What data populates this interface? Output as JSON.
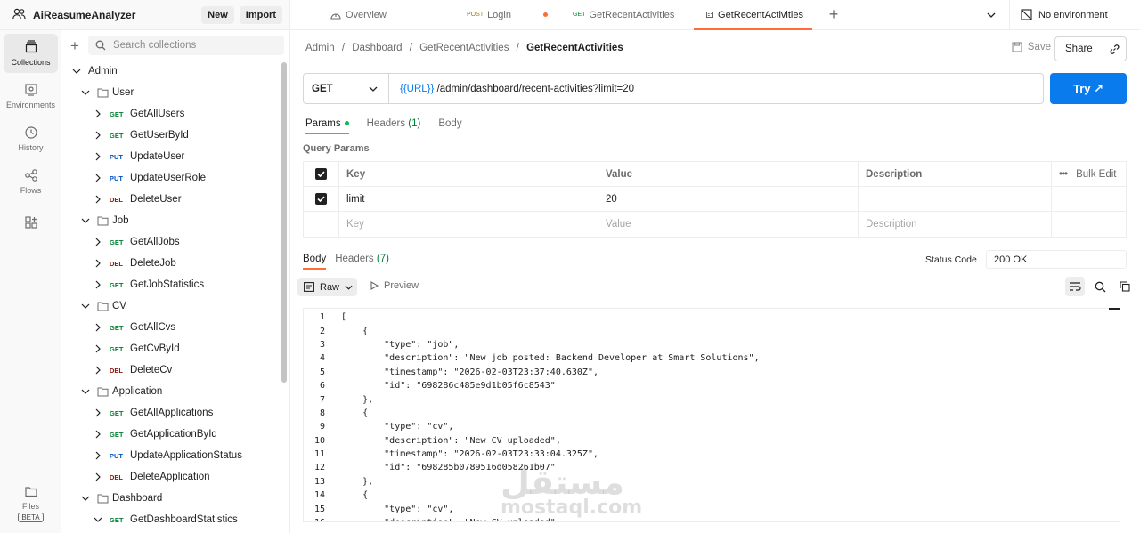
{
  "workspace": {
    "title": "AiReasumeAnalyzer",
    "new_label": "New",
    "import_label": "Import"
  },
  "rail": [
    {
      "label": "Collections",
      "icon": "collections-icon",
      "active": true
    },
    {
      "label": "Environments",
      "icon": "environments-icon",
      "active": false
    },
    {
      "label": "History",
      "icon": "history-icon",
      "active": false
    },
    {
      "label": "Flows",
      "icon": "flows-icon",
      "active": false
    },
    {
      "label": "",
      "icon": "add-apps-icon",
      "active": false
    },
    {
      "label": "Files",
      "icon": "files-icon",
      "badge": "BETA"
    }
  ],
  "sidebar": {
    "search_placeholder": "Search collections",
    "tree": {
      "admin": "Admin",
      "user": "User",
      "user_items": [
        {
          "method": "GET",
          "name": "GetAllUsers"
        },
        {
          "method": "GET",
          "name": "GetUserById"
        },
        {
          "method": "PUT",
          "name": "UpdateUser"
        },
        {
          "method": "PUT",
          "name": "UpdateUserRole"
        },
        {
          "method": "DEL",
          "name": "DeleteUser"
        }
      ],
      "job": "Job",
      "job_items": [
        {
          "method": "GET",
          "name": "GetAllJobs"
        },
        {
          "method": "DEL",
          "name": "DeleteJob"
        },
        {
          "method": "GET",
          "name": "GetJobStatistics"
        }
      ],
      "cv": "CV",
      "cv_items": [
        {
          "method": "GET",
          "name": "GetAllCvs"
        },
        {
          "method": "GET",
          "name": "GetCvById"
        },
        {
          "method": "DEL",
          "name": "DeleteCv"
        }
      ],
      "application": "Application",
      "application_items": [
        {
          "method": "GET",
          "name": "GetAllApplications"
        },
        {
          "method": "GET",
          "name": "GetApplicationById"
        },
        {
          "method": "PUT",
          "name": "UpdateApplicationStatus"
        },
        {
          "method": "DEL",
          "name": "DeleteApplication"
        }
      ],
      "dashboard": "Dashboard",
      "dashboard_items": [
        {
          "method": "GET",
          "name": "GetDashboardStatistics"
        }
      ]
    }
  },
  "tabs": [
    {
      "label": "Overview",
      "method": ""
    },
    {
      "label": "Login",
      "method": "POST"
    },
    {
      "label": "GetRecentActivities",
      "method": "GET"
    },
    {
      "label": "GetRecentActivities",
      "method": ""
    }
  ],
  "environment": "No environment",
  "breadcrumb": [
    "Admin",
    "Dashboard",
    "GetRecentActivities",
    "GetRecentActivities"
  ],
  "save_label": "Save",
  "share_label": "Share",
  "request": {
    "method": "GET",
    "url_var": "{{URL}}",
    "url_path": " /admin/dashboard/recent-activities?limit=20",
    "try_label": "Try ↗"
  },
  "request_tabs": {
    "params": "Params",
    "headers": "Headers",
    "headers_count": "(1)",
    "body": "Body"
  },
  "query_params": {
    "title": "Query Params",
    "headers": {
      "key": "Key",
      "value": "Value",
      "description": "Description",
      "bulk": "Bulk Edit"
    },
    "rows": [
      {
        "key": "limit",
        "value": "20",
        "description": ""
      }
    ],
    "placeholders": {
      "key": "Key",
      "value": "Value",
      "description": "Description"
    }
  },
  "response": {
    "body_tab": "Body",
    "headers_tab": "Headers",
    "headers_count": "(7)",
    "status_label": "Status Code",
    "status_value": "200 OK",
    "format": "Raw",
    "preview": "Preview",
    "lines": [
      "[",
      "    {",
      "        \"type\": \"job\",",
      "        \"description\": \"New job posted: Backend Developer at Smart Solutions\",",
      "        \"timestamp\": \"2026-02-03T23:37:40.630Z\",",
      "        \"id\": \"698286c485e9d1b05f6c8543\"",
      "    },",
      "    {",
      "        \"type\": \"cv\",",
      "        \"description\": \"New CV uploaded\",",
      "        \"timestamp\": \"2026-02-03T23:33:04.325Z\",",
      "        \"id\": \"698285b0789516d058261b07\"",
      "    },",
      "    {",
      "        \"type\": \"cv\",",
      "        \"description\": \"New CV uploaded\","
    ]
  },
  "watermark": {
    "arabic": "مستقل",
    "latin": "mostaql.com"
  },
  "colors": {
    "accent": "#ff6c37",
    "primary": "#097bed",
    "get": "#007f31",
    "put": "#0053b8",
    "del": "#8e1a10",
    "post": "#ad7a03"
  }
}
